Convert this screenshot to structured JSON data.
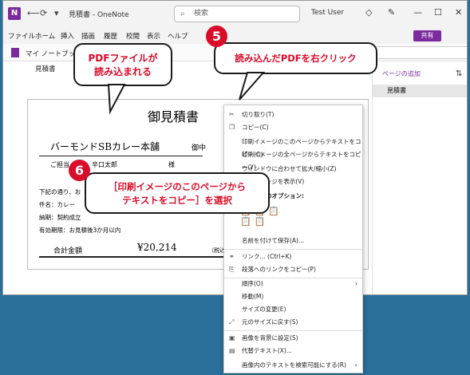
{
  "window": {
    "title": "見積書 - OneNote",
    "search_placeholder": "検索",
    "user": "Test User"
  },
  "menu": [
    "ファイル",
    "ホーム",
    "挿入",
    "描画",
    "履歴",
    "校閲",
    "表示",
    "ヘルプ"
  ],
  "share_label": "共有",
  "notebook": {
    "label": "マイ ノートブック",
    "search": "の検索"
  },
  "pdf_icon_label": "見積書",
  "document": {
    "title": "御見積書",
    "company": "バーモンドSBカレー本舗",
    "honorific": "御中",
    "rep_label": "ご担当",
    "rep_name": "辛口太郎",
    "rep_suffix": "様",
    "line1": "下記の通り、お",
    "line2": "件名：カレー",
    "line3": "納期：契約成立",
    "line4": "有効期限：お見積後3か月以内",
    "total_label": "合計金額",
    "total_amount": "¥20,214",
    "total_tax": "（税込）"
  },
  "sidepanel": {
    "add_page": "ページの追加",
    "page": "見積書"
  },
  "context_menu": [
    {
      "label": "切り取り(T)",
      "icon": "scissors-icon"
    },
    {
      "label": "コピー(C)",
      "icon": "copy-icon"
    },
    {
      "label": "印刷イメージのこのページからテキストをコピー(Q)",
      "icon": ""
    },
    {
      "label": "印刷イメージの全ページからテキストをコピー(Y)",
      "icon": ""
    },
    {
      "label": "ウインドウに合わせて拡大/縮小(Z)",
      "icon": ""
    },
    {
      "label": "印刷イメージを表示(V)",
      "icon": ""
    },
    {
      "label": "貼り付けのオプション:",
      "icon": ""
    },
    {
      "label": "名前を付けて保存(A)...",
      "icon": ""
    },
    {
      "label": "リンク...  (Ctrl+K)",
      "icon": "link-icon"
    },
    {
      "label": "段落へのリンクをコピー(P)",
      "icon": "paragraph-link-icon"
    },
    {
      "label": "順序(O)",
      "icon": ""
    },
    {
      "label": "移動(M)",
      "icon": ""
    },
    {
      "label": "サイズの変更(E)",
      "icon": ""
    },
    {
      "label": "元のサイズに戻す(S)",
      "icon": "resize-icon"
    },
    {
      "label": "画像を背景に設定(S)",
      "icon": "background-icon"
    },
    {
      "label": "代替テキスト(X)...",
      "icon": "alt-text-icon"
    },
    {
      "label": "画像内のテキストを検索可能にする(R)",
      "icon": ""
    }
  ],
  "callouts": {
    "pdf_loaded": "PDFファイルが\n読み込まれる",
    "step5_badge": "5",
    "step5": "読み込んだPDFを右クリック",
    "step6_badge": "6",
    "step6": "［印刷イメージのこのページから\nテキストをコピー］を選択"
  },
  "accent_color": "#d90c2a",
  "brand_color": "#7b2b9e"
}
